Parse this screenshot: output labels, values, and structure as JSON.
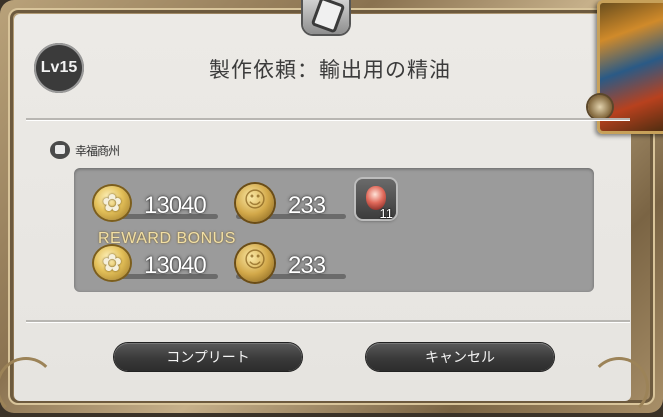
{
  "header": {
    "level": "Lv15",
    "title": "製作依頼：輸出用の精油"
  },
  "category": {
    "icon": "chest-icon",
    "label": "幸福商州"
  },
  "rewards": {
    "base": {
      "scrip": "13040",
      "gil": "233",
      "item_count": "11"
    },
    "bonus_label": "REWARD BONUS",
    "bonus": {
      "scrip": "13040",
      "gil": "233"
    }
  },
  "buttons": {
    "complete": "コンプリート",
    "cancel": "キャンセル"
  },
  "colors": {
    "frame_gold": "#b9a27a",
    "panel": "#e9e7e3",
    "reward_box": "#9b9b9b",
    "bonus_text": "#f2dfa3"
  }
}
